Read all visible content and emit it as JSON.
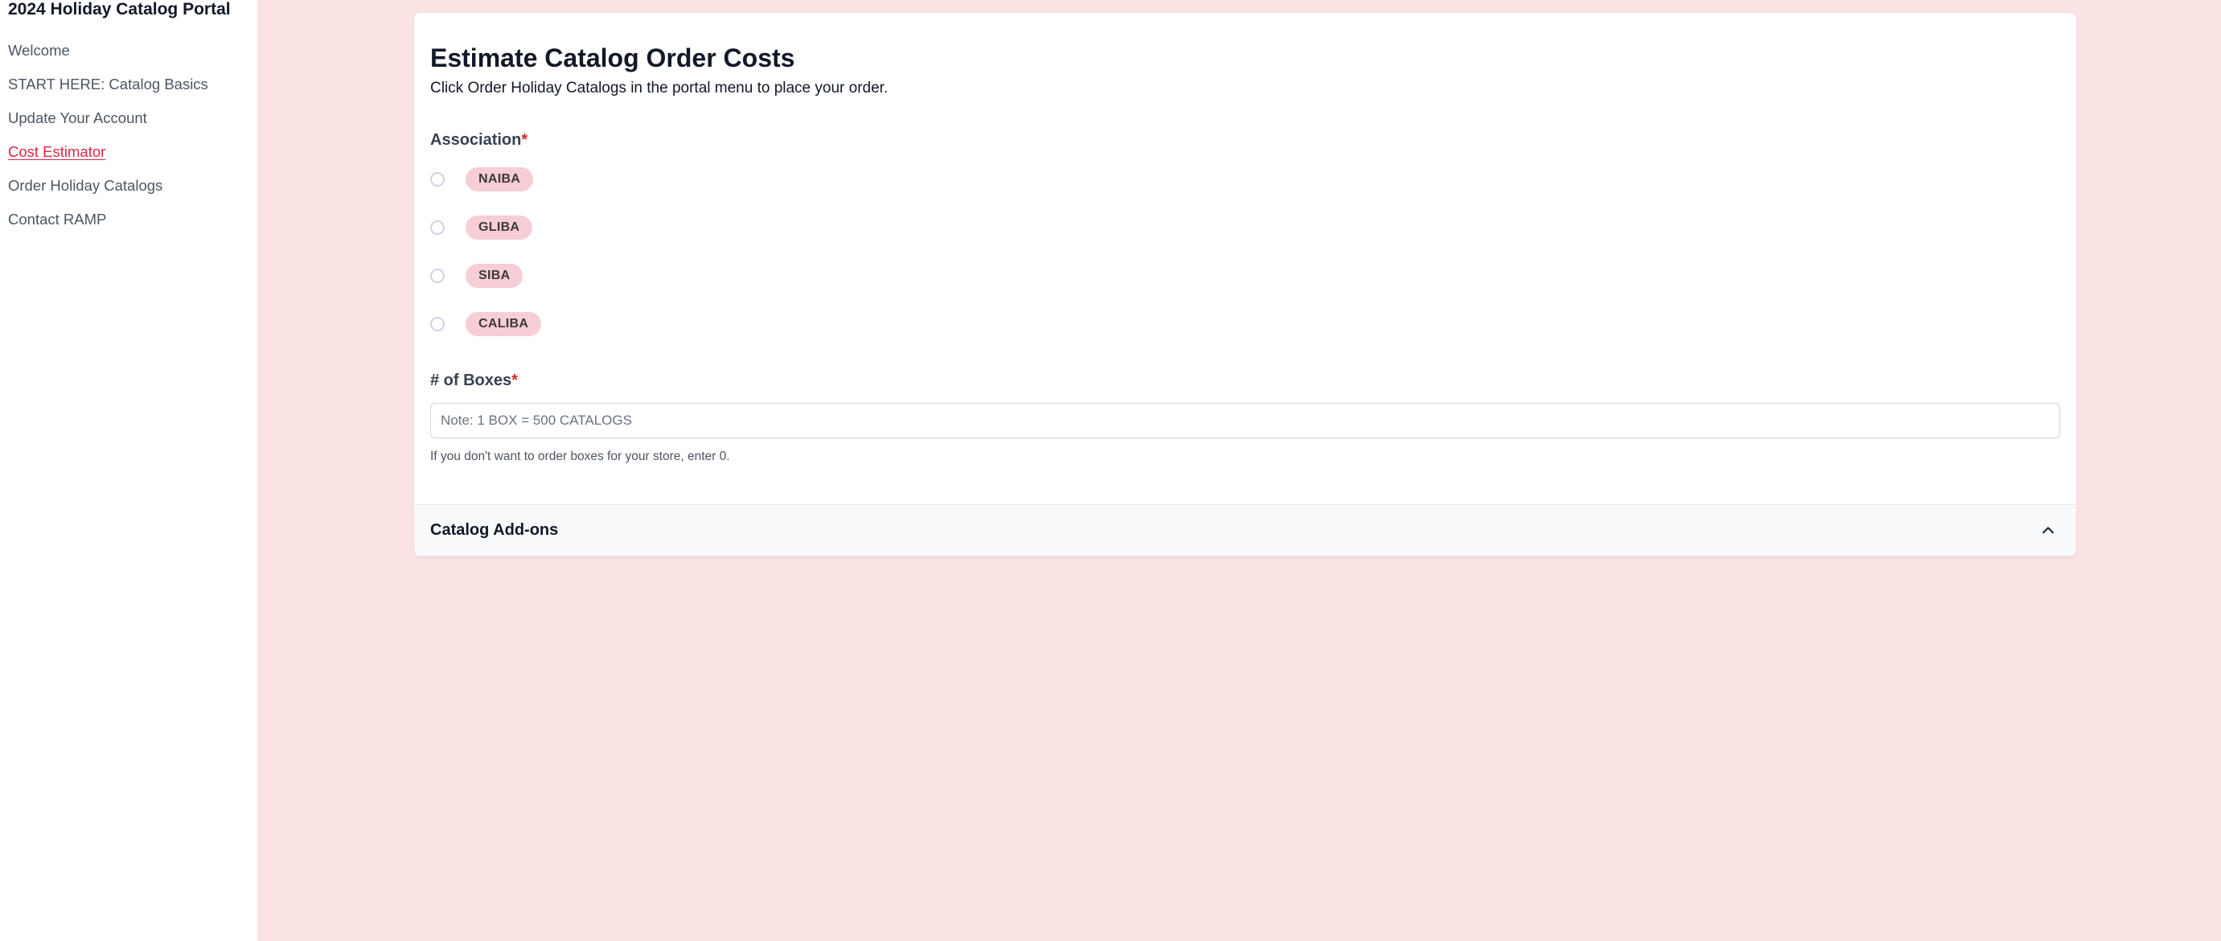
{
  "sidebar": {
    "title": "2024 Holiday Catalog Portal",
    "items": [
      {
        "label": "Welcome",
        "active": false
      },
      {
        "label": "START HERE: Catalog Basics",
        "active": false
      },
      {
        "label": "Update Your Account",
        "active": false
      },
      {
        "label": "Cost Estimator",
        "active": true
      },
      {
        "label": "Order Holiday Catalogs",
        "active": false
      },
      {
        "label": "Contact RAMP",
        "active": false
      }
    ]
  },
  "main": {
    "title": "Estimate Catalog Order Costs",
    "subtitle": "Click Order Holiday Catalogs in the portal menu to place your order.",
    "association": {
      "label": "Association",
      "required_mark": "*",
      "options": [
        "NAIBA",
        "GLIBA",
        "SIBA",
        "CALIBA"
      ]
    },
    "boxes": {
      "label": "# of Boxes",
      "required_mark": "*",
      "placeholder": "Note: 1 BOX = 500 CATALOGS",
      "help": "If you don't want to order boxes for your store, enter 0."
    },
    "addons": {
      "header": "Catalog Add-ons"
    }
  }
}
